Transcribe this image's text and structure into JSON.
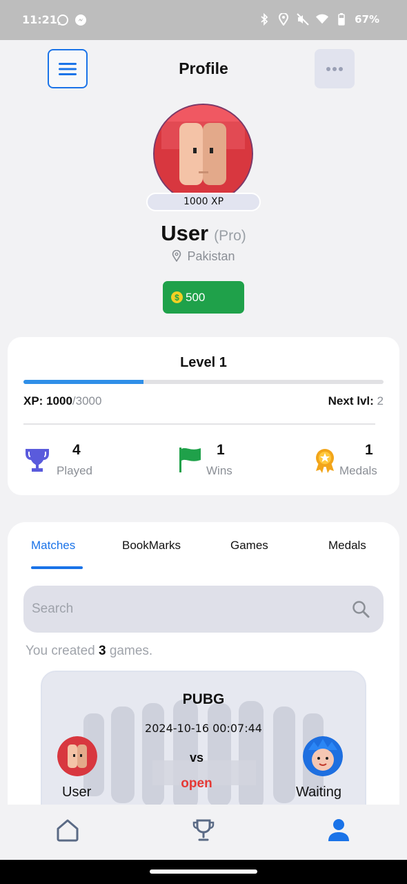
{
  "status_bar": {
    "time": "11:21",
    "battery": "67%"
  },
  "header": {
    "title": "Profile"
  },
  "profile": {
    "xp_badge": "1000 XP",
    "name": "User",
    "tier": "(Pro)",
    "location": "Pakistan",
    "coins": "500"
  },
  "level_card": {
    "level": "Level 1",
    "progress_fraction": 0.333,
    "xp_label": "XP:",
    "xp_current": "1000",
    "xp_total": "/3000",
    "next_label": "Next lvl:",
    "next_value": "2",
    "stats": [
      {
        "value": "4",
        "label": "Played",
        "icon": "trophy-icon"
      },
      {
        "value": "1",
        "label": "Wins",
        "icon": "flag-icon"
      },
      {
        "value": "1",
        "label": "Medals",
        "icon": "medal-icon"
      }
    ]
  },
  "tabs": [
    {
      "label": "Matches",
      "active": true
    },
    {
      "label": "BookMarks",
      "active": false
    },
    {
      "label": "Games",
      "active": false
    },
    {
      "label": "Medals",
      "active": false
    }
  ],
  "search": {
    "placeholder": "Search"
  },
  "created_summary": {
    "prefix": "You created",
    "count": "3",
    "suffix": "games."
  },
  "match": {
    "game": "PUBG",
    "datetime": "2024-10-16 00:07:44",
    "vs": "vs",
    "status": "open",
    "player1": "User",
    "player2": "Waiting"
  },
  "colors": {
    "accent": "#1a73e8",
    "coins_bg": "#1fa14a",
    "progress": "#2f8fe8",
    "status_open": "#e53935"
  }
}
